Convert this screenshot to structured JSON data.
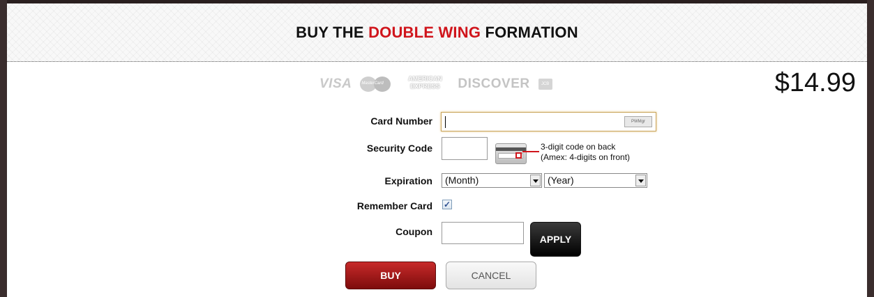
{
  "dialog": {
    "title_prefix": "BUY THE ",
    "title_accent": "DOUBLE WING",
    "title_suffix": " FORMATION",
    "price": "$14.99"
  },
  "accepted_cards": {
    "visa": "VISA",
    "mastercard": "MasterCard",
    "amex_line1": "AMERICAN",
    "amex_line2": "EXPRESS",
    "discover": "DISCOVER",
    "jcb": "JCB"
  },
  "form": {
    "card_number_label": "Card Number",
    "card_number_value": "",
    "password_manager_icon_text": "PWMgr",
    "security_code_label": "Security Code",
    "security_code_value": "",
    "security_hint_line1": "3-digit code on back",
    "security_hint_line2": "(Amex: 4-digits on front)",
    "expiration_label": "Expiration",
    "month_selected": "(Month)",
    "year_selected": "(Year)",
    "remember_card_label": "Remember Card",
    "remember_card_checked": true,
    "checkbox_mark": "✓",
    "coupon_label": "Coupon",
    "coupon_value": ""
  },
  "buttons": {
    "apply": "APPLY",
    "buy": "BUY",
    "cancel": "CANCEL"
  },
  "colors": {
    "accent_red": "#d0151c",
    "buy_button": "#9e1a1a",
    "apply_button": "#111111"
  },
  "icons": {
    "security_code": "card-back-cvv-icon",
    "password_manager": "password-manager-icon",
    "dropdown": "chevron-down-icon"
  }
}
